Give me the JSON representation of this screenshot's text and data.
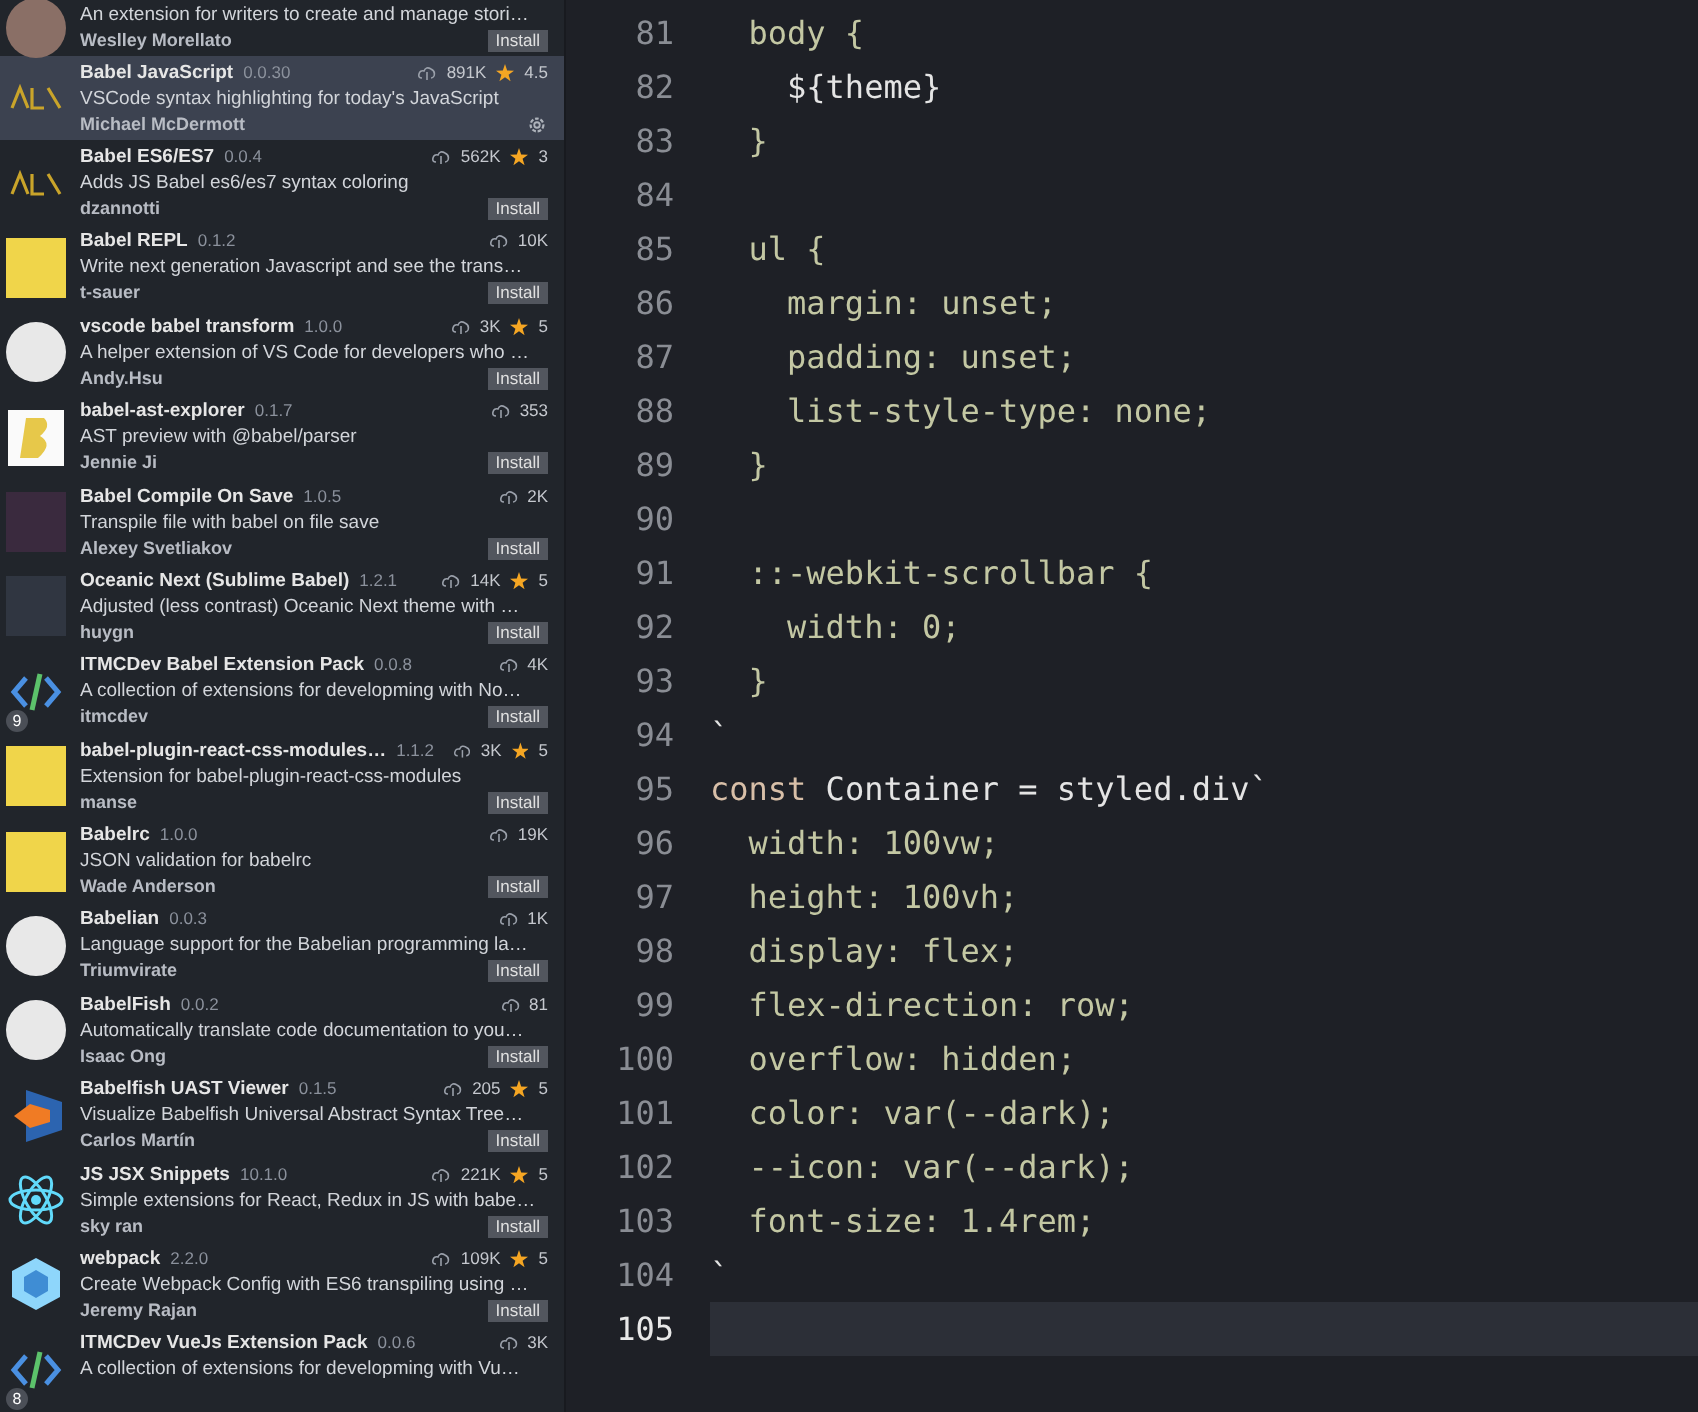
{
  "extensions": [
    {
      "kind": "circle-dark",
      "description": "An extension for writers to create and manage stori…",
      "publisher": "Weslley Morellato",
      "action": "Install",
      "selected": false
    },
    {
      "kind": "babel",
      "name": "Babel JavaScript",
      "version": "0.0.30",
      "downloads": "891K",
      "rating": "4.5",
      "description": "VSCode syntax highlighting for today's JavaScript",
      "publisher": "Michael McDermott",
      "selected": true
    },
    {
      "kind": "babel",
      "name": "Babel ES6/ES7",
      "version": "0.0.4",
      "downloads": "562K",
      "rating": "3",
      "description": "Adds JS Babel es6/es7 syntax coloring",
      "publisher": "dzannotti",
      "action": "Install",
      "selected": false
    },
    {
      "kind": "yellow",
      "name": "Babel REPL",
      "version": "0.1.2",
      "downloads": "10K",
      "description": "Write next generation Javascript and see the trans…",
      "publisher": "t-sauer",
      "action": "Install",
      "selected": false
    },
    {
      "kind": "circle",
      "name": "vscode babel transform",
      "version": "1.0.0",
      "downloads": "3K",
      "rating": "5",
      "description": "A helper extension of VS Code for developers who …",
      "publisher": "Andy.Hsu",
      "action": "Install",
      "selected": false
    },
    {
      "kind": "letter",
      "name": "babel-ast-explorer",
      "version": "0.1.7",
      "downloads": "353",
      "description": "AST preview with @babel/parser",
      "publisher": "Jennie Ji",
      "action": "Install",
      "selected": false
    },
    {
      "kind": "purple",
      "name": "Babel Compile On Save",
      "version": "1.0.5",
      "downloads": "2K",
      "description": "Transpile file with babel on file save",
      "publisher": "Alexey Svetliakov",
      "action": "Install",
      "selected": false
    },
    {
      "kind": "dark",
      "name": "Oceanic Next (Sublime Babel)",
      "version": "1.2.1",
      "downloads": "14K",
      "rating": "5",
      "description": "Adjusted (less contrast) Oceanic Next theme with …",
      "publisher": "huygn",
      "action": "Install",
      "selected": false
    },
    {
      "kind": "code",
      "badge": "9",
      "name": "ITMCDev Babel Extension Pack",
      "version": "0.0.8",
      "downloads": "4K",
      "description": "A collection of extensions for developming with No…",
      "publisher": "itmcdev",
      "action": "Install",
      "selected": false
    },
    {
      "kind": "yellow",
      "name": "babel-plugin-react-css-modules…",
      "version": "1.1.2",
      "downloads": "3K",
      "rating": "5",
      "description": "Extension for babel-plugin-react-css-modules",
      "publisher": "manse",
      "action": "Install",
      "selected": false
    },
    {
      "kind": "yellow",
      "name": "Babelrc",
      "version": "1.0.0",
      "downloads": "19K",
      "description": "JSON validation for babelrc",
      "publisher": "Wade Anderson",
      "action": "Install",
      "selected": false
    },
    {
      "kind": "circle",
      "name": "Babelian",
      "version": "0.0.3",
      "downloads": "1K",
      "description": "Language support for the Babelian programming la…",
      "publisher": "Triumvirate",
      "action": "Install",
      "selected": false
    },
    {
      "kind": "circle",
      "name": "BabelFish",
      "version": "0.0.2",
      "downloads": "81",
      "description": "Automatically translate code documentation to you…",
      "publisher": "Isaac Ong",
      "action": "Install",
      "selected": false
    },
    {
      "kind": "fish",
      "name": "Babelfish UAST Viewer",
      "version": "0.1.5",
      "downloads": "205",
      "rating": "5",
      "description": "Visualize Babelfish Universal Abstract Syntax Tree…",
      "publisher": "Carlos Martín",
      "action": "Install",
      "selected": false
    },
    {
      "kind": "atom",
      "name": "JS JSX Snippets",
      "version": "10.1.0",
      "downloads": "221K",
      "rating": "5",
      "description": "Simple extensions for React, Redux in JS with babe…",
      "publisher": "sky ran",
      "action": "Install",
      "selected": false
    },
    {
      "kind": "hex",
      "name": "webpack",
      "version": "2.2.0",
      "downloads": "109K",
      "rating": "5",
      "description": "Create Webpack Config with ES6 transpiling using …",
      "publisher": "Jeremy Rajan",
      "action": "Install",
      "selected": false
    },
    {
      "kind": "code",
      "badge": "8",
      "name": "ITMCDev VueJs Extension Pack",
      "version": "0.0.6",
      "downloads": "3K",
      "description": "A collection of extensions for developming with Vu…",
      "selected": false
    }
  ],
  "editor": {
    "lines": [
      {
        "number": "81",
        "current": false,
        "tokens": [
          {
            "text": "  body {",
            "kind": "css"
          }
        ]
      },
      {
        "number": "82",
        "current": false,
        "tokens": [
          {
            "text": "    ${theme}",
            "kind": "plain"
          }
        ]
      },
      {
        "number": "83",
        "current": false,
        "tokens": [
          {
            "text": "  }",
            "kind": "css"
          }
        ]
      },
      {
        "number": "84",
        "current": false
      },
      {
        "number": "85",
        "current": false,
        "tokens": [
          {
            "text": "  ul {",
            "kind": "css"
          }
        ]
      },
      {
        "number": "86",
        "current": false,
        "tokens": [
          {
            "text": "    margin: unset;",
            "kind": "css"
          }
        ]
      },
      {
        "number": "87",
        "current": false,
        "tokens": [
          {
            "text": "    padding: unset;",
            "kind": "css"
          }
        ]
      },
      {
        "number": "88",
        "current": false,
        "tokens": [
          {
            "text": "    list-style-type: none;",
            "kind": "css"
          }
        ]
      },
      {
        "number": "89",
        "current": false,
        "tokens": [
          {
            "text": "  }",
            "kind": "css"
          }
        ]
      },
      {
        "number": "90",
        "current": false
      },
      {
        "number": "91",
        "current": false,
        "tokens": [
          {
            "text": "  ::-webkit-scrollbar {",
            "kind": "css"
          }
        ]
      },
      {
        "number": "92",
        "current": false,
        "tokens": [
          {
            "text": "    width: 0;",
            "kind": "css"
          }
        ]
      },
      {
        "number": "93",
        "current": false,
        "tokens": [
          {
            "text": "  }",
            "kind": "css"
          }
        ]
      },
      {
        "number": "94",
        "current": false,
        "tokens": [
          {
            "text": "`",
            "kind": "plain"
          }
        ]
      },
      {
        "number": "95",
        "current": false,
        "tokens": [
          {
            "text": "const",
            "kind": "keyword"
          },
          {
            "text": " Container = styled.div`",
            "kind": "plain"
          }
        ]
      },
      {
        "number": "96",
        "current": false,
        "tokens": [
          {
            "text": "  width: 100vw;",
            "kind": "css"
          }
        ]
      },
      {
        "number": "97",
        "current": false,
        "tokens": [
          {
            "text": "  height: 100vh;",
            "kind": "css"
          }
        ]
      },
      {
        "number": "98",
        "current": false,
        "tokens": [
          {
            "text": "  display: flex;",
            "kind": "css"
          }
        ]
      },
      {
        "number": "99",
        "current": false,
        "tokens": [
          {
            "text": "  flex-direction: row;",
            "kind": "css"
          }
        ]
      },
      {
        "number": "100",
        "current": false,
        "tokens": [
          {
            "text": "  overflow: hidden;",
            "kind": "css"
          }
        ]
      },
      {
        "number": "101",
        "current": false,
        "tokens": [
          {
            "text": "  color: var(--dark);",
            "kind": "css"
          }
        ]
      },
      {
        "number": "102",
        "current": false,
        "tokens": [
          {
            "text": "  --icon: var(--dark);",
            "kind": "css"
          }
        ]
      },
      {
        "number": "103",
        "current": false,
        "tokens": [
          {
            "text": "  font-size: 1.4rem;",
            "kind": "css"
          }
        ]
      },
      {
        "number": "104",
        "current": false,
        "tokens": [
          {
            "text": "`",
            "kind": "plain"
          }
        ]
      },
      {
        "number": "105",
        "current": true
      }
    ]
  }
}
